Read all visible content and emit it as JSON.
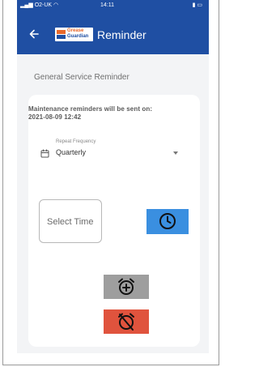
{
  "status_bar": {
    "carrier": "O2-UK",
    "time": "14:11"
  },
  "app_bar": {
    "logo_line1": "Grease",
    "logo_line2": "Guardian",
    "title": "Reminder",
    "color": "#1f4fa3"
  },
  "page": {
    "section_title": "General Service Reminder",
    "notice_line1": "Maintenance reminders will be sent on:",
    "notice_line2": "2021-08-09 12:42"
  },
  "repeat_frequency": {
    "label": "Repeat Frequency",
    "value": "Quarterly"
  },
  "time_input": {
    "placeholder": "Select Time"
  },
  "buttons": {
    "clock_color": "#3a8fe0",
    "add_alarm_color": "#9e9e9e",
    "alarm_off_color": "#e0533d"
  },
  "icons": [
    "back-arrow-icon",
    "calendar-icon",
    "clock-icon",
    "alarm-add-icon",
    "alarm-off-icon",
    "chevron-down-icon"
  ]
}
